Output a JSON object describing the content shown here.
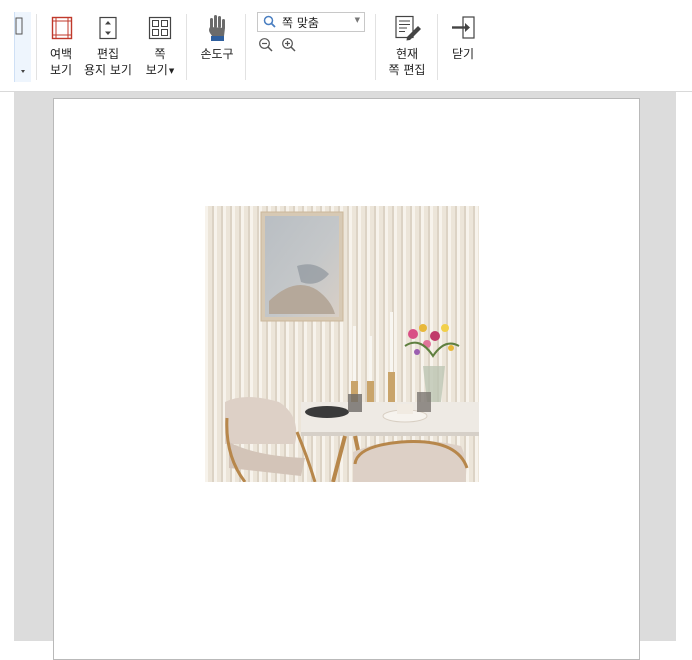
{
  "toolbar": {
    "margin_view": {
      "line1": "여백",
      "line2": "보기"
    },
    "edit_paper_view": {
      "line1": "편집",
      "line2": "용지 보기"
    },
    "page_view": {
      "line1": "쪽",
      "line2": "보기"
    },
    "hand_tool": {
      "label": "손도구"
    },
    "zoom": {
      "value": "쪽 맞춤"
    },
    "current_page_edit": {
      "line1": "현재",
      "line2": "쪽 편집"
    },
    "close": {
      "label": "닫기"
    }
  },
  "colors": {
    "accent": "#4a7fc1",
    "red_icon": "#c0392b",
    "doc_background": "#dcdcdc"
  },
  "icons": {
    "margin_view": "margin-view-icon",
    "edit_paper_view": "paper-view-icon",
    "page_view": "page-grid-icon",
    "hand_tool": "hand-icon",
    "zoom_search": "magnifier-icon",
    "zoom_out": "zoom-out-icon",
    "zoom_in": "zoom-in-icon",
    "current_page_edit": "page-edit-icon",
    "close": "close-exit-icon"
  }
}
